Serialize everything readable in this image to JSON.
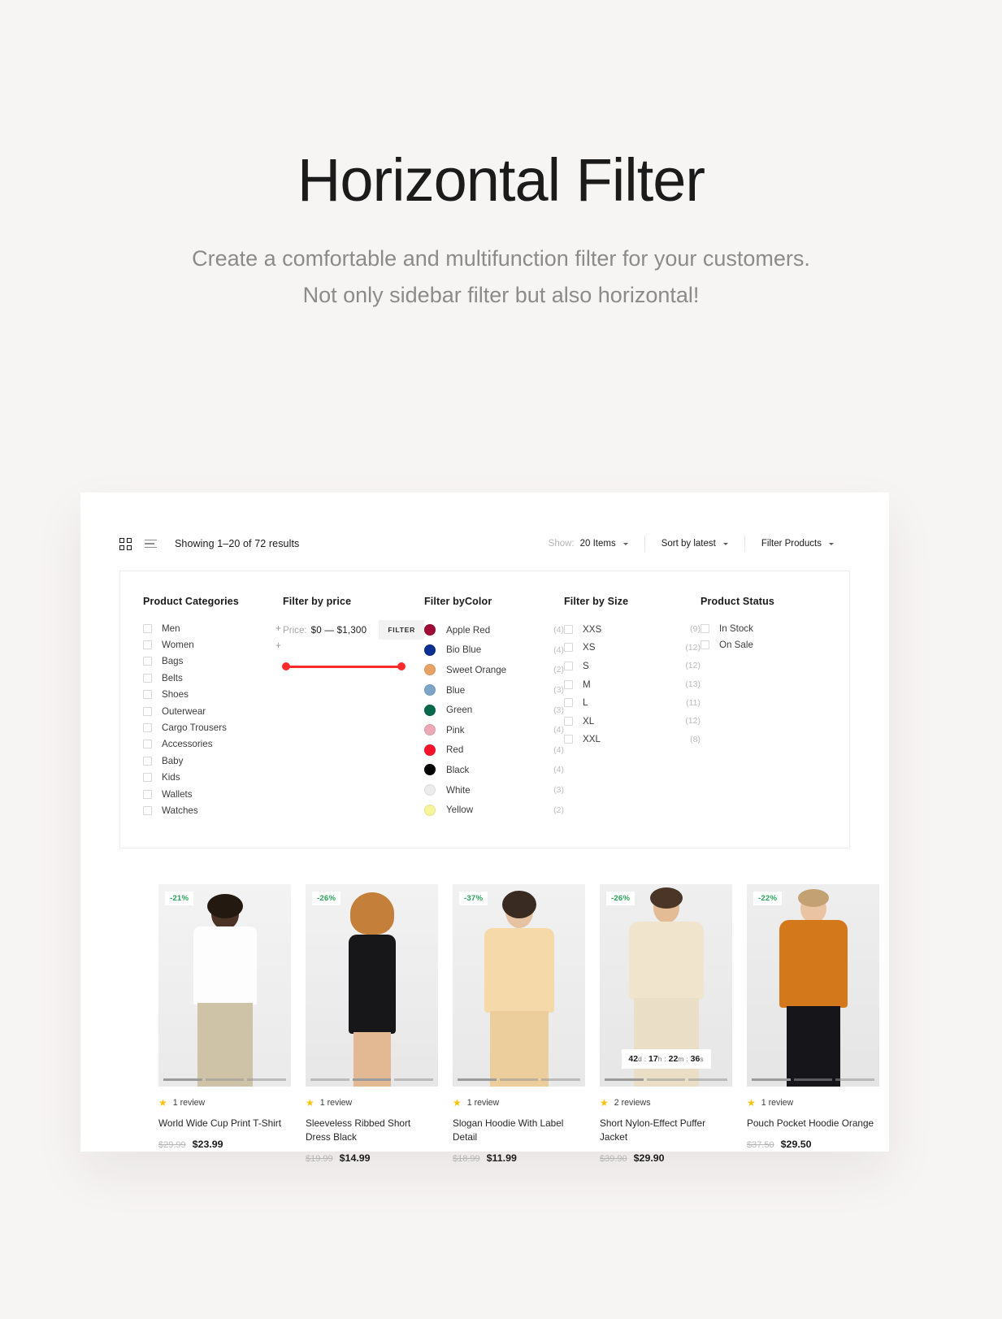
{
  "hero": {
    "title": "Horizontal Filter",
    "subtitle_line1": "Create a comfortable and multifunction filter for your customers.",
    "subtitle_line2": "Not only sidebar filter but also horizontal!"
  },
  "toolbar": {
    "grid_icon": "grid-view-icon",
    "list_icon": "list-view-icon",
    "results": "Showing 1–20 of 72 results",
    "show_label": "Show:",
    "show_value": "20 Items",
    "sort_value": "Sort by latest",
    "filter_products": "Filter Products"
  },
  "filters": {
    "categories": {
      "title": "Product Categories",
      "items": [
        {
          "label": "Men",
          "expand": "+"
        },
        {
          "label": "Women",
          "expand": "+"
        },
        {
          "label": "Bags",
          "expand": ""
        },
        {
          "label": "Belts",
          "expand": ""
        },
        {
          "label": "Shoes",
          "expand": ""
        },
        {
          "label": "Outerwear",
          "expand": ""
        },
        {
          "label": "Cargo Trousers",
          "expand": ""
        },
        {
          "label": "Accessories",
          "expand": ""
        },
        {
          "label": "Baby",
          "expand": ""
        },
        {
          "label": "Kids",
          "expand": ""
        },
        {
          "label": "Wallets",
          "expand": ""
        },
        {
          "label": "Watches",
          "expand": ""
        }
      ]
    },
    "price": {
      "title": "Filter by price",
      "label": "Price:",
      "range": "$0 — $1,300",
      "button": "FILTER",
      "min": 0,
      "max": 1300,
      "accent": "#ff2b2b"
    },
    "color": {
      "title": "Filter byColor",
      "items": [
        {
          "label": "Apple Red",
          "count": "(4)",
          "hex": "#9e0b36"
        },
        {
          "label": "Bio Blue",
          "count": "(4)",
          "hex": "#0b2f8f"
        },
        {
          "label": "Sweet Orange",
          "count": "(2)",
          "hex": "#e8a263"
        },
        {
          "label": "Blue",
          "count": "(3)",
          "hex": "#7ea4c9"
        },
        {
          "label": "Green",
          "count": "(3)",
          "hex": "#04694a"
        },
        {
          "label": "Pink",
          "count": "(4)",
          "hex": "#eca8b6"
        },
        {
          "label": "Red",
          "count": "(4)",
          "hex": "#f5142c"
        },
        {
          "label": "Black",
          "count": "(4)",
          "hex": "#000000"
        },
        {
          "label": "White",
          "count": "(3)",
          "hex": "#ececec"
        },
        {
          "label": "Yellow",
          "count": "(2)",
          "hex": "#f7f59b"
        }
      ]
    },
    "size": {
      "title": "Filter by Size",
      "items": [
        {
          "label": "XXS",
          "count": "(9)"
        },
        {
          "label": "XS",
          "count": "(12)"
        },
        {
          "label": "S",
          "count": "(12)"
        },
        {
          "label": "M",
          "count": "(13)"
        },
        {
          "label": "L",
          "count": "(11)"
        },
        {
          "label": "XL",
          "count": "(12)"
        },
        {
          "label": "XXL",
          "count": "(8)"
        }
      ]
    },
    "status": {
      "title": "Product Status",
      "items": [
        {
          "label": "In Stock"
        },
        {
          "label": "On Sale"
        }
      ]
    }
  },
  "products": [
    {
      "badge": "-21%",
      "reviews": "1 review",
      "title": "World Wide Cup Print T-Shirt",
      "old_price": "$29.99",
      "new_price": "$23.99",
      "countdown": null
    },
    {
      "badge": "-26%",
      "reviews": "1 review",
      "title": "Sleeveless Ribbed Short Dress Black",
      "old_price": "$19.99",
      "new_price": "$14.99",
      "countdown": null
    },
    {
      "badge": "-37%",
      "reviews": "1 review",
      "title": "Slogan Hoodie With Label Detail",
      "old_price": "$18.99",
      "new_price": "$11.99",
      "countdown": null
    },
    {
      "badge": "-26%",
      "reviews": "2 reviews",
      "title": "Short Nylon-Effect Puffer Jacket",
      "old_price": "$39.90",
      "new_price": "$29.90",
      "countdown": {
        "days": "42",
        "d": "d",
        "hours": "17",
        "h": "h",
        "minutes": "22",
        "m": "m",
        "seconds": "36",
        "s": "s"
      }
    },
    {
      "badge": "-22%",
      "reviews": "1 review",
      "title": "Pouch Pocket Hoodie Orange",
      "old_price": "$37.50",
      "new_price": "$29.50",
      "countdown": null
    }
  ]
}
